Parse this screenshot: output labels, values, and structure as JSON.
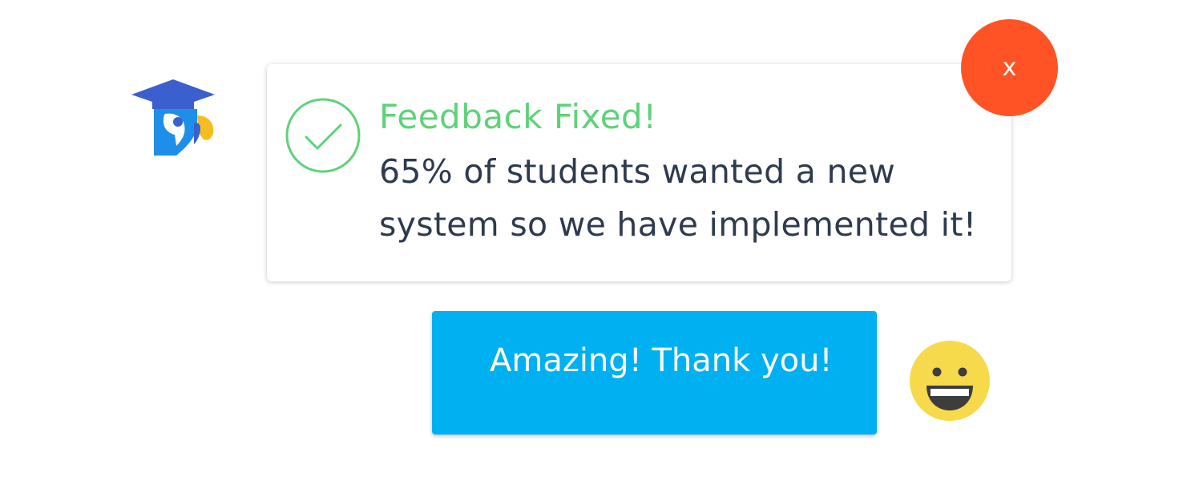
{
  "colors": {
    "success_green": "#5ed27a",
    "close_red": "#ff5325",
    "reply_blue": "#00b0f0",
    "message_text": "#2e3b4e",
    "emoji_yellow": "#f7d94c"
  },
  "bot": {
    "icon": "parrot-graduation-cap-logo"
  },
  "feedback_card": {
    "icon": "checkmark-circle-icon",
    "title": "Feedback Fixed!",
    "message": "65% of students wanted a new system so we have implemented it!"
  },
  "close_button": {
    "label": "x"
  },
  "reply": {
    "label": "Amazing! Thank you!"
  },
  "emoji": {
    "icon": "grinning-face-emoji"
  }
}
